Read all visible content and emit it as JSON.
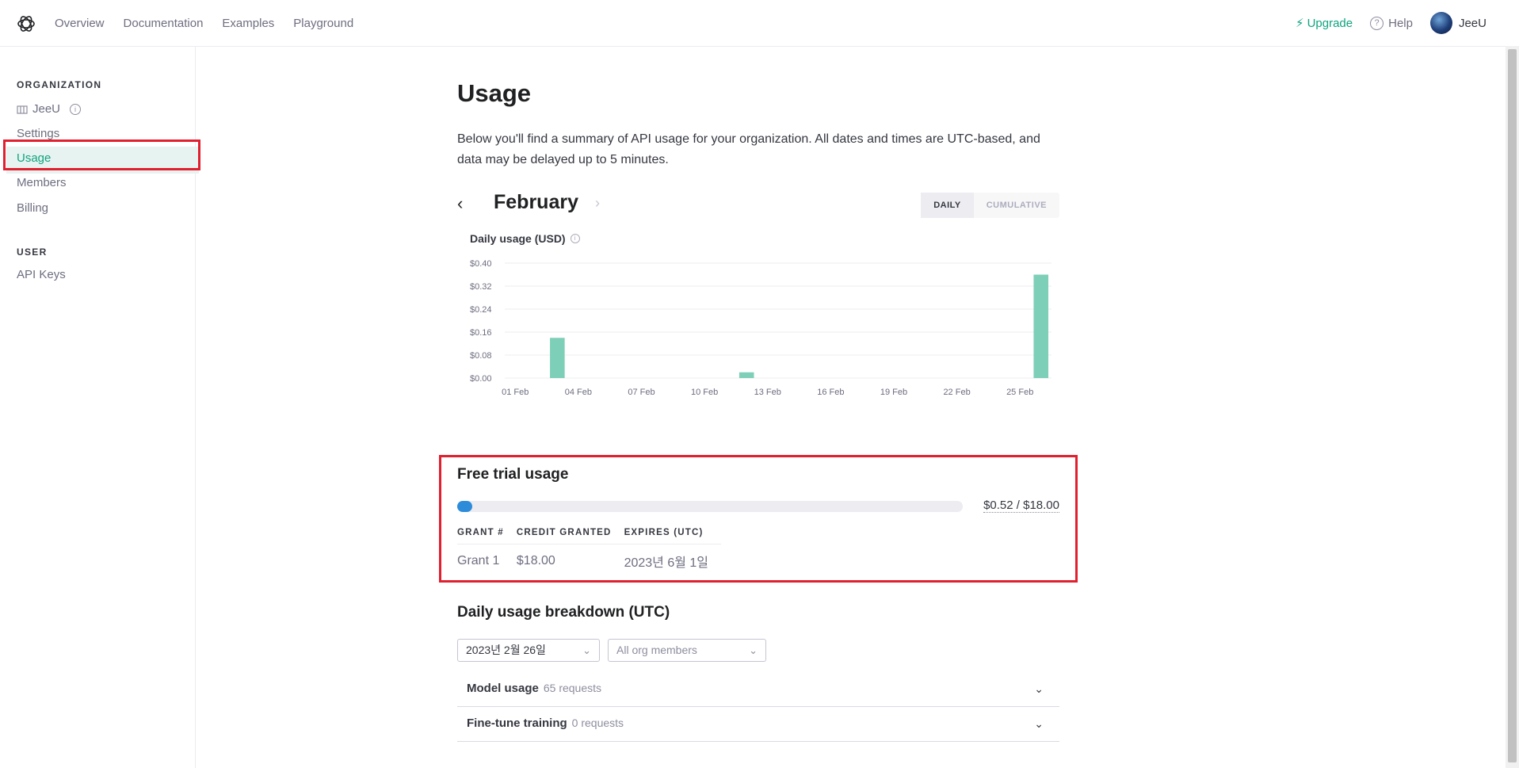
{
  "nav": {
    "links": [
      "Overview",
      "Documentation",
      "Examples",
      "Playground"
    ],
    "upgrade": "Upgrade",
    "help": "Help",
    "user": "JeeU"
  },
  "sidebar": {
    "org_heading": "ORGANIZATION",
    "org_name": "JeeU",
    "items": [
      "Settings",
      "Usage",
      "Members",
      "Billing"
    ],
    "user_heading": "USER",
    "user_items": [
      "API Keys"
    ]
  },
  "main": {
    "title": "Usage",
    "intro": "Below you'll find a summary of API usage for your organization. All dates and times are UTC-based, and data may be delayed up to 5 minutes.",
    "month": "February",
    "toggle": {
      "daily": "DAILY",
      "cumulative": "CUMULATIVE"
    },
    "chart_title": "Daily usage (USD)"
  },
  "chart_data": {
    "type": "bar",
    "title": "Daily usage (USD)",
    "ylim": [
      0,
      0.4
    ],
    "y_ticks": [
      "$0.40",
      "$0.32",
      "$0.24",
      "$0.16",
      "$0.08",
      "$0.00"
    ],
    "x_ticks": [
      "01 Feb",
      "04 Feb",
      "07 Feb",
      "10 Feb",
      "13 Feb",
      "16 Feb",
      "19 Feb",
      "22 Feb",
      "25 Feb"
    ],
    "bar_color": "#7ecfb8",
    "categories": [
      "01 Feb",
      "02 Feb",
      "03 Feb",
      "04 Feb",
      "05 Feb",
      "06 Feb",
      "07 Feb",
      "08 Feb",
      "09 Feb",
      "10 Feb",
      "11 Feb",
      "12 Feb",
      "13 Feb",
      "14 Feb",
      "15 Feb",
      "16 Feb",
      "17 Feb",
      "18 Feb",
      "19 Feb",
      "20 Feb",
      "21 Feb",
      "22 Feb",
      "23 Feb",
      "24 Feb",
      "25 Feb",
      "26 Feb"
    ],
    "values": [
      0,
      0,
      0.14,
      0,
      0,
      0,
      0,
      0,
      0,
      0,
      0,
      0.02,
      0,
      0,
      0,
      0,
      0,
      0,
      0,
      0,
      0,
      0,
      0,
      0,
      0,
      0.36
    ]
  },
  "trial": {
    "title": "Free trial usage",
    "progress_text": "$0.52 / $18.00",
    "progress_fraction": 0.029,
    "progress_color": "#2d8cda",
    "headers": [
      "GRANT #",
      "CREDIT GRANTED",
      "EXPIRES (UTC)"
    ],
    "rows": [
      [
        "Grant 1",
        "$18.00",
        "2023년 6월 1일"
      ]
    ]
  },
  "breakdown": {
    "title": "Daily usage breakdown (UTC)",
    "date_select": "2023년 2월 26일",
    "member_select": "All org members",
    "sections": [
      {
        "name": "Model usage",
        "count": "65 requests"
      },
      {
        "name": "Fine-tune training",
        "count": "0 requests"
      }
    ]
  }
}
